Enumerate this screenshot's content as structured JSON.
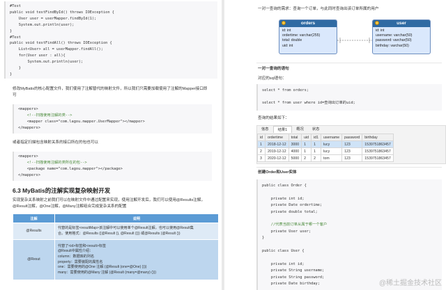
{
  "left": {
    "code1": [
      "#Test",
      "public void testFindById() throws IOException {",
      "    User user = userMapper.findById(1);",
      "    System.out.println(user);",
      "}",
      "#Test",
      "public void testFindAll() throws IOException {",
      "    List<User> all = userMapper.findAll();",
      "    for(User user : all){",
      "        System.out.println(user);",
      "    }",
      "}"
    ],
    "para1": "修改MyBatis的核心配置文件，我们使用了注解替代的映射文件，所以我们只需要加载使用了注解的Mapper接口即可",
    "code2": [
      "<mappers>",
      "    <!--扫描使用注解的类-->",
      "    <mapper class=\"com.lagou.mapper.UserMapper\"></mapper>",
      "</mappers>"
    ],
    "para2": "或者指定扫描包含映射关系的接口所在的包也可以",
    "code3": [
      "<mappers>",
      "    <!--扫描使用注解的类所在的包-->",
      "    <package name=\"com.lagou.mapper\"></package>",
      "</mappers>"
    ],
    "heading": "6.3 MyBatis的注解实现复杂映射开发",
    "para3": "实现复杂关系映射之前我们可以在映射文件中通过配置来实现，使用注解开发后，我们可以使用@Results注解，@Result注解，@One注解，@Many注解组合完成复杂关系的配置",
    "table": {
      "headers": [
        "注解",
        "说明"
      ],
      "rows": [
        {
          "name": "@Results",
          "lines": [
            "代替的是标签<resultMap>该注解中可以使用单个@Result注解，也可以使用@Result集",
            "合。使用格式：@Results ({@Result (), @Result ()}) 或@Results (@Result ())"
          ]
        },
        {
          "name": "@Resut",
          "lines": [
            "代替了<id>标签和<result>标签",
            "@Result中属性介绍：",
            "column：数据库的列名",
            "property：需要装配的属性名",
            "one：需要使用的@One 注解 (@Result (one=@One) ()))",
            "many：需要使用的@Many 注解 (@Result (many=@many) ()))"
          ]
        }
      ]
    }
  },
  "right": {
    "intro": "一对一查询的需求：查询一个订单，与此同时查询出该订单所属的用户",
    "er": {
      "orders": {
        "title": "orders",
        "fields": [
          "id: int",
          "ordertime: varchar(255)",
          "total: double",
          "uid: int"
        ]
      },
      "user": {
        "title": "user",
        "fields": [
          "id: int",
          "username: varchar(50)",
          "password: varchar(50)",
          "birthday: varchar(50)"
        ]
      }
    },
    "sql_heading": "一对一查询的语句",
    "sql_label": "对应的sql语句：",
    "sql_code": [
      "select * from orders;",
      "",
      "select * from user where id=查询出订单的uid;"
    ],
    "result_label": "查询的结果如下：",
    "tabs": [
      "信息",
      "结果1",
      "概况",
      "状态"
    ],
    "grid": {
      "columns": [
        "id",
        "ordertime",
        "total",
        "uid",
        "id1",
        "username",
        "password",
        "birthday"
      ],
      "rows": [
        [
          "1",
          "2018-12-12",
          "3000",
          "1",
          "1",
          "lucy",
          "123",
          "1539751863457"
        ],
        [
          "2",
          "2019-12-12",
          "4000",
          "1",
          "1",
          "lucy",
          "123",
          "1539751863457"
        ],
        [
          "3",
          "2020-12-12",
          "5000",
          "2",
          "2",
          "tom",
          "123",
          "1539751863457"
        ]
      ]
    },
    "entity_heading": "创建Order和User实体",
    "code_order": [
      "public class Order {",
      "",
      "    private int id;",
      "    private Date ordertime;",
      "    private double total;",
      "",
      "    //代表当前订单从属于哪一个客户",
      "    private User user;",
      "}",
      "",
      "public class User {",
      "",
      "    private int id;",
      "    private String username;",
      "    private String password;",
      "    private Date birthday;"
    ]
  },
  "watermark": "@稀土掘金技术社区"
}
